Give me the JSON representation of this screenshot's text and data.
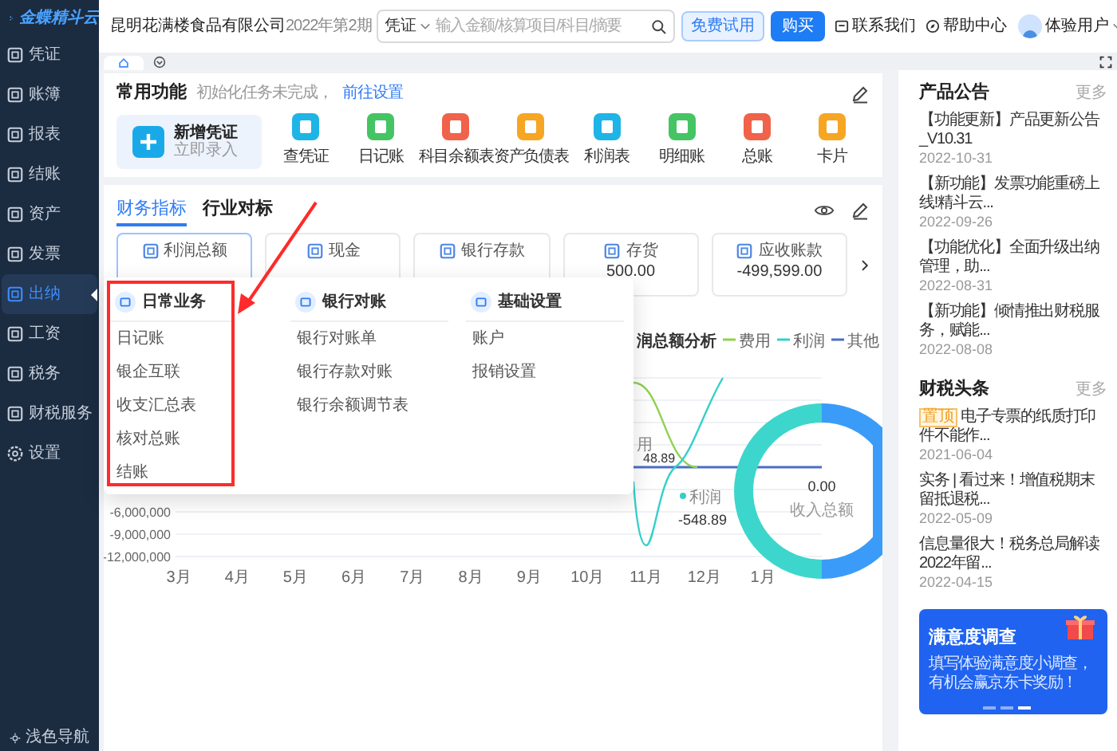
{
  "sidebar": {
    "logo": "金蝶精斗云",
    "items": [
      {
        "label": "凭证",
        "selected": false
      },
      {
        "label": "账簿",
        "selected": false
      },
      {
        "label": "报表",
        "selected": false
      },
      {
        "label": "结账",
        "selected": false
      },
      {
        "label": "资产",
        "selected": false
      },
      {
        "label": "发票",
        "selected": false
      },
      {
        "label": "出纳",
        "selected": true
      },
      {
        "label": "工资",
        "selected": false
      },
      {
        "label": "税务",
        "selected": false
      },
      {
        "label": "财税服务",
        "selected": false
      },
      {
        "label": "设置",
        "selected": false
      }
    ],
    "footer": "浅色导航"
  },
  "header": {
    "company": "昆明花满楼食品有限公司",
    "period": "2022年第2期",
    "search": {
      "scope": "凭证",
      "placeholder": "输入金额/核算项目/科目/摘要"
    },
    "buttons": [
      {
        "label": "免费试用",
        "kind": "outline"
      },
      {
        "label": "购买",
        "kind": "primary"
      }
    ],
    "links": [
      "联系我们",
      "帮助中心"
    ],
    "user": "体验用户"
  },
  "page_tabs": [
    {
      "selected": true
    }
  ],
  "shortcuts": {
    "title": "常用功能",
    "hint": "初始化任务未完成，",
    "hint_link": "前往设置",
    "primary": {
      "title": "新增凭证",
      "subtitle": "立即录入"
    },
    "items": [
      {
        "label": "查凭证",
        "color": "#1fb4e6"
      },
      {
        "label": "日记账",
        "color": "#45c464"
      },
      {
        "label": "科目余额表",
        "color": "#f0624a"
      },
      {
        "label": "资产负债表",
        "color": "#f6a623"
      },
      {
        "label": "利润表",
        "color": "#1fb4e6"
      },
      {
        "label": "明细账",
        "color": "#45c464"
      },
      {
        "label": "总账",
        "color": "#f0624a"
      },
      {
        "label": "卡片",
        "color": "#f6a623"
      }
    ]
  },
  "indicators": {
    "tabs": [
      {
        "label": "财务指标",
        "selected": true
      },
      {
        "label": "行业对标",
        "selected": false
      }
    ],
    "cards": [
      {
        "label": "利润总额",
        "selected": true
      },
      {
        "label": "现金",
        "selected": false
      },
      {
        "label": "银行存款",
        "selected": false
      },
      {
        "label": "存货",
        "selected": false,
        "value": "500.00"
      },
      {
        "label": "应收账款",
        "selected": false,
        "value": "-499,599.00"
      }
    ]
  },
  "chart": {
    "title": "润总额分析",
    "legend": [
      {
        "label": "费用",
        "color": "#8fd14f"
      },
      {
        "label": "利润",
        "color": "#36cfc9"
      },
      {
        "label": "其他",
        "color": "#4a6fc4"
      }
    ],
    "y_labels": [
      "-6,000,000",
      "-9,000,000",
      "-12,000,000"
    ],
    "x_labels": [
      "3月",
      "4月",
      "5月",
      "6月",
      "7月",
      "8月",
      "9月",
      "10月",
      "11月",
      "12月",
      "1月"
    ],
    "point_labels": {
      "expense_name": "用",
      "expense_value": "48.89",
      "profit_name": "利润",
      "profit_value": "-548.89"
    },
    "donut": {
      "value": "0.00",
      "label": "收入总额"
    }
  },
  "menu": {
    "columns": [
      {
        "title": "日常业务",
        "highlighted": true,
        "items": [
          "日记账",
          "银企互联",
          "收支汇总表",
          "核对总账",
          "结账"
        ]
      },
      {
        "title": "银行对账",
        "highlighted": false,
        "items": [
          "银行对账单",
          "银行存款对账",
          "银行余额调节表"
        ]
      },
      {
        "title": "基础设置",
        "highlighted": false,
        "items": [
          "账户",
          "报销设置"
        ]
      }
    ]
  },
  "announcements": {
    "title": "产品公告",
    "more": "更多",
    "items": [
      {
        "text": "【功能更新】产品更新公告_V10.31",
        "date": "2022-10-31"
      },
      {
        "text": "【新功能】发票功能重磅上线!精斗云...",
        "date": "2022-09-26"
      },
      {
        "text": "【功能优化】全面升级出纳管理，助...",
        "date": "2022-08-31"
      },
      {
        "text": "【新功能】倾情推出财税服务，赋能...",
        "date": "2022-08-08"
      }
    ]
  },
  "news": {
    "title": "财税头条",
    "more": "更多",
    "items": [
      {
        "tag": "置顶",
        "text": "电子专票的纸质打印件不能作...",
        "date": "2021-06-04"
      },
      {
        "text": "实务 | 看过来！增值税期末留抵退税...",
        "date": "2022-05-09"
      },
      {
        "text": "信息量很大！税务总局解读2022年留...",
        "date": "2022-04-15"
      }
    ]
  },
  "banner": {
    "title": "满意度调查",
    "lines": [
      "填写体验满意度小调查，",
      "有机会赢京东卡奖励！"
    ]
  }
}
